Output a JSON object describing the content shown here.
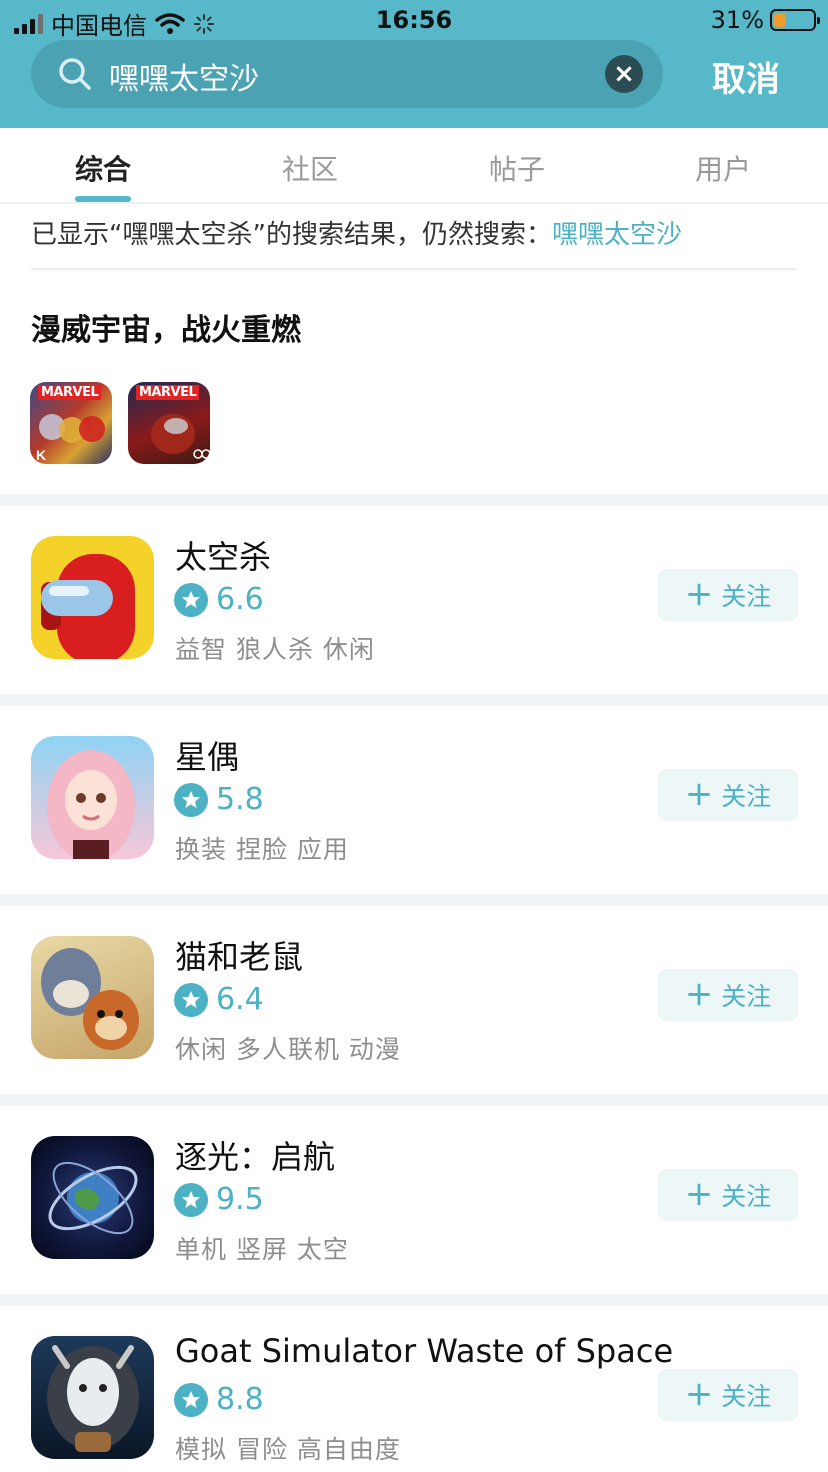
{
  "status_bar": {
    "carrier": "中国电信",
    "time": "16:56",
    "battery_percent": "31%",
    "battery_level": 0.31
  },
  "search": {
    "query": "嘿嘿太空沙",
    "cancel_label": "取消"
  },
  "tabs": [
    {
      "label": "综合",
      "active": true
    },
    {
      "label": "社区",
      "active": false
    },
    {
      "label": "帖子",
      "active": false
    },
    {
      "label": "用户",
      "active": false
    }
  ],
  "suggestion": {
    "prefix": "已显示“嘿嘿太空杀”的搜索结果，仍然搜索：",
    "link": "嘿嘿太空沙"
  },
  "promo": {
    "title": "漫威宇宙，战火重燃",
    "icons": [
      {
        "badge": "MARVEL"
      },
      {
        "badge": "MARVEL"
      }
    ]
  },
  "results": [
    {
      "name": "太空杀",
      "rating": "6.6",
      "tags": "益智 狼人杀 休闲",
      "follow_label": "关注"
    },
    {
      "name": "星偶",
      "rating": "5.8",
      "tags": "换装 捏脸 应用",
      "follow_label": "关注"
    },
    {
      "name": "猫和老鼠",
      "rating": "6.4",
      "tags": "休闲 多人联机 动漫",
      "follow_label": "关注"
    },
    {
      "name": "逐光：启航",
      "rating": "9.5",
      "tags": "单机 竖屏 太空",
      "follow_label": "关注"
    },
    {
      "name": "Goat Simulator Waste of Space",
      "rating": "8.8",
      "tags": "模拟 冒险 高自由度",
      "follow_label": "关注"
    }
  ],
  "colors": {
    "header": "#57b8c9",
    "accent": "#4db1c4",
    "battery": "#f19b2c"
  }
}
